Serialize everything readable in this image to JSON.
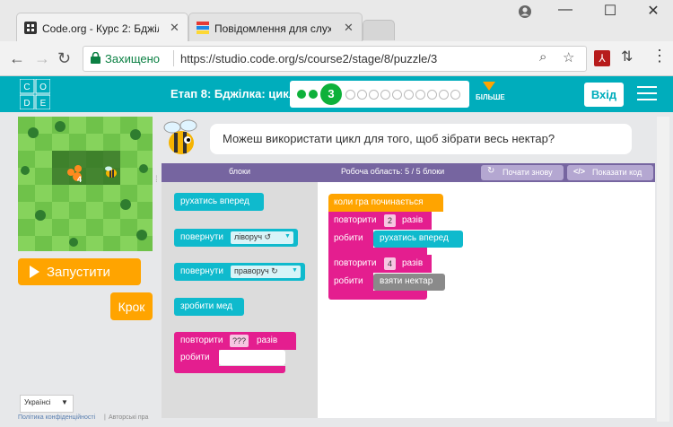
{
  "browser": {
    "tabs": [
      {
        "title": "Code.org - Курс 2: Бджіл"
      },
      {
        "title": "Повідомлення для слухач"
      }
    ],
    "secure_label": "Захищено",
    "url": "https://studio.code.org/s/course2/stage/8/puzzle/3"
  },
  "header": {
    "stage_title": "Етап 8: Бджілка: цикли",
    "current_puzzle": "3",
    "more_label": "БІЛЬШЕ",
    "signin_label": "Вхід"
  },
  "instructions": {
    "text": "Можеш використати цикл для того, щоб зібрати весь нектар?"
  },
  "toolbar": {
    "toolbox_title": "блоки",
    "workspace_title": "Робоча область: 5 / 5 блоки",
    "restart_label": "Почати знову",
    "show_code_label": "Показати код"
  },
  "game": {
    "run_label": "Запустити",
    "step_label": "Крок",
    "nectar_count": "4"
  },
  "toolbox": {
    "move_forward": "рухатись вперед",
    "turn_label": "повернути",
    "turn_left": "ліворуч ↺",
    "turn_right": "праворуч ↻",
    "make_honey": "зробити мед",
    "repeat_label": "повторити",
    "repeat_value": "???",
    "times_label": "разів",
    "do_label": "робити"
  },
  "workspace": {
    "when_run": "коли гра починається",
    "repeat1_label": "повторити",
    "repeat1_value": "2",
    "repeat1_times": "разів",
    "repeat1_do": "робити",
    "repeat1_inner": "рухатись вперед",
    "repeat2_label": "повторити",
    "repeat2_value": "4",
    "repeat2_times": "разів",
    "repeat2_do": "робити",
    "repeat2_inner": "взяти нектар"
  },
  "footer": {
    "language": "Українсі",
    "privacy": "Політика конфіденційності",
    "copyright": "Авторські пра"
  },
  "colors": {
    "header": "#00adbc",
    "run_button": "#ffa400",
    "toolbar": "#7665a0",
    "motion_block": "#0fbacd",
    "loop_block": "#e41e8f",
    "event_block": "#ffa400",
    "action_block": "#8a8a8a"
  }
}
